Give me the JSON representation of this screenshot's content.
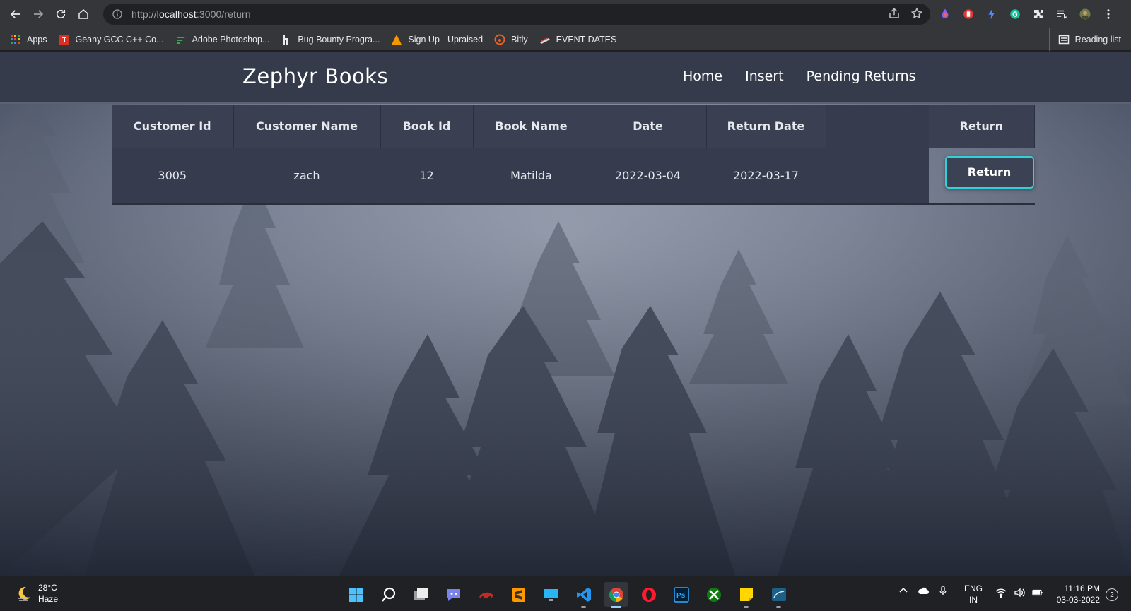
{
  "browser": {
    "url_scheme": "http://",
    "url_host": "localhost",
    "url_path": ":3000/return",
    "bookmarks": [
      {
        "label": "Apps",
        "icon": "apps-grid-icon",
        "color": "#ea4335"
      },
      {
        "label": "Geany GCC C++ Co...",
        "icon": "geany-icon",
        "color": "#d93025"
      },
      {
        "label": "Adobe Photoshop...",
        "icon": "photoshop-bookmark-icon",
        "color": "#34a853"
      },
      {
        "label": "Bug Bounty Progra...",
        "icon": "hackerone-icon",
        "color": "#e8eaed"
      },
      {
        "label": "Sign Up - Upraised",
        "icon": "upraised-icon",
        "color": "#f29900"
      },
      {
        "label": "Bitly",
        "icon": "bitly-icon",
        "color": "#ee6123"
      },
      {
        "label": "EVENT DATES",
        "icon": "event-icon",
        "color": "#e8eaed"
      }
    ],
    "reading_list": "Reading list"
  },
  "site": {
    "brand": "Zephyr Books",
    "nav": [
      "Home",
      "Insert",
      "Pending Returns"
    ]
  },
  "table": {
    "headers": [
      "Customer Id",
      "Customer Name",
      "Book Id",
      "Book Name",
      "Date",
      "Return Date",
      "Return"
    ],
    "rows": [
      {
        "customer_id": "3005",
        "customer_name": "zach",
        "book_id": "12",
        "book_name": "Matilda",
        "date": "2022-03-04",
        "return_date": "2022-03-17",
        "action": "Return"
      }
    ]
  },
  "taskbar": {
    "temp": "28°C",
    "weather": "Haze",
    "lang": "ENG",
    "region": "IN",
    "time": "11:16 PM",
    "date": "03-03-2022",
    "notifications": "2"
  },
  "colors": {
    "nav_bg": "#353b4a",
    "table_bg": "#363c4d",
    "button_border": "#34d0d8"
  }
}
